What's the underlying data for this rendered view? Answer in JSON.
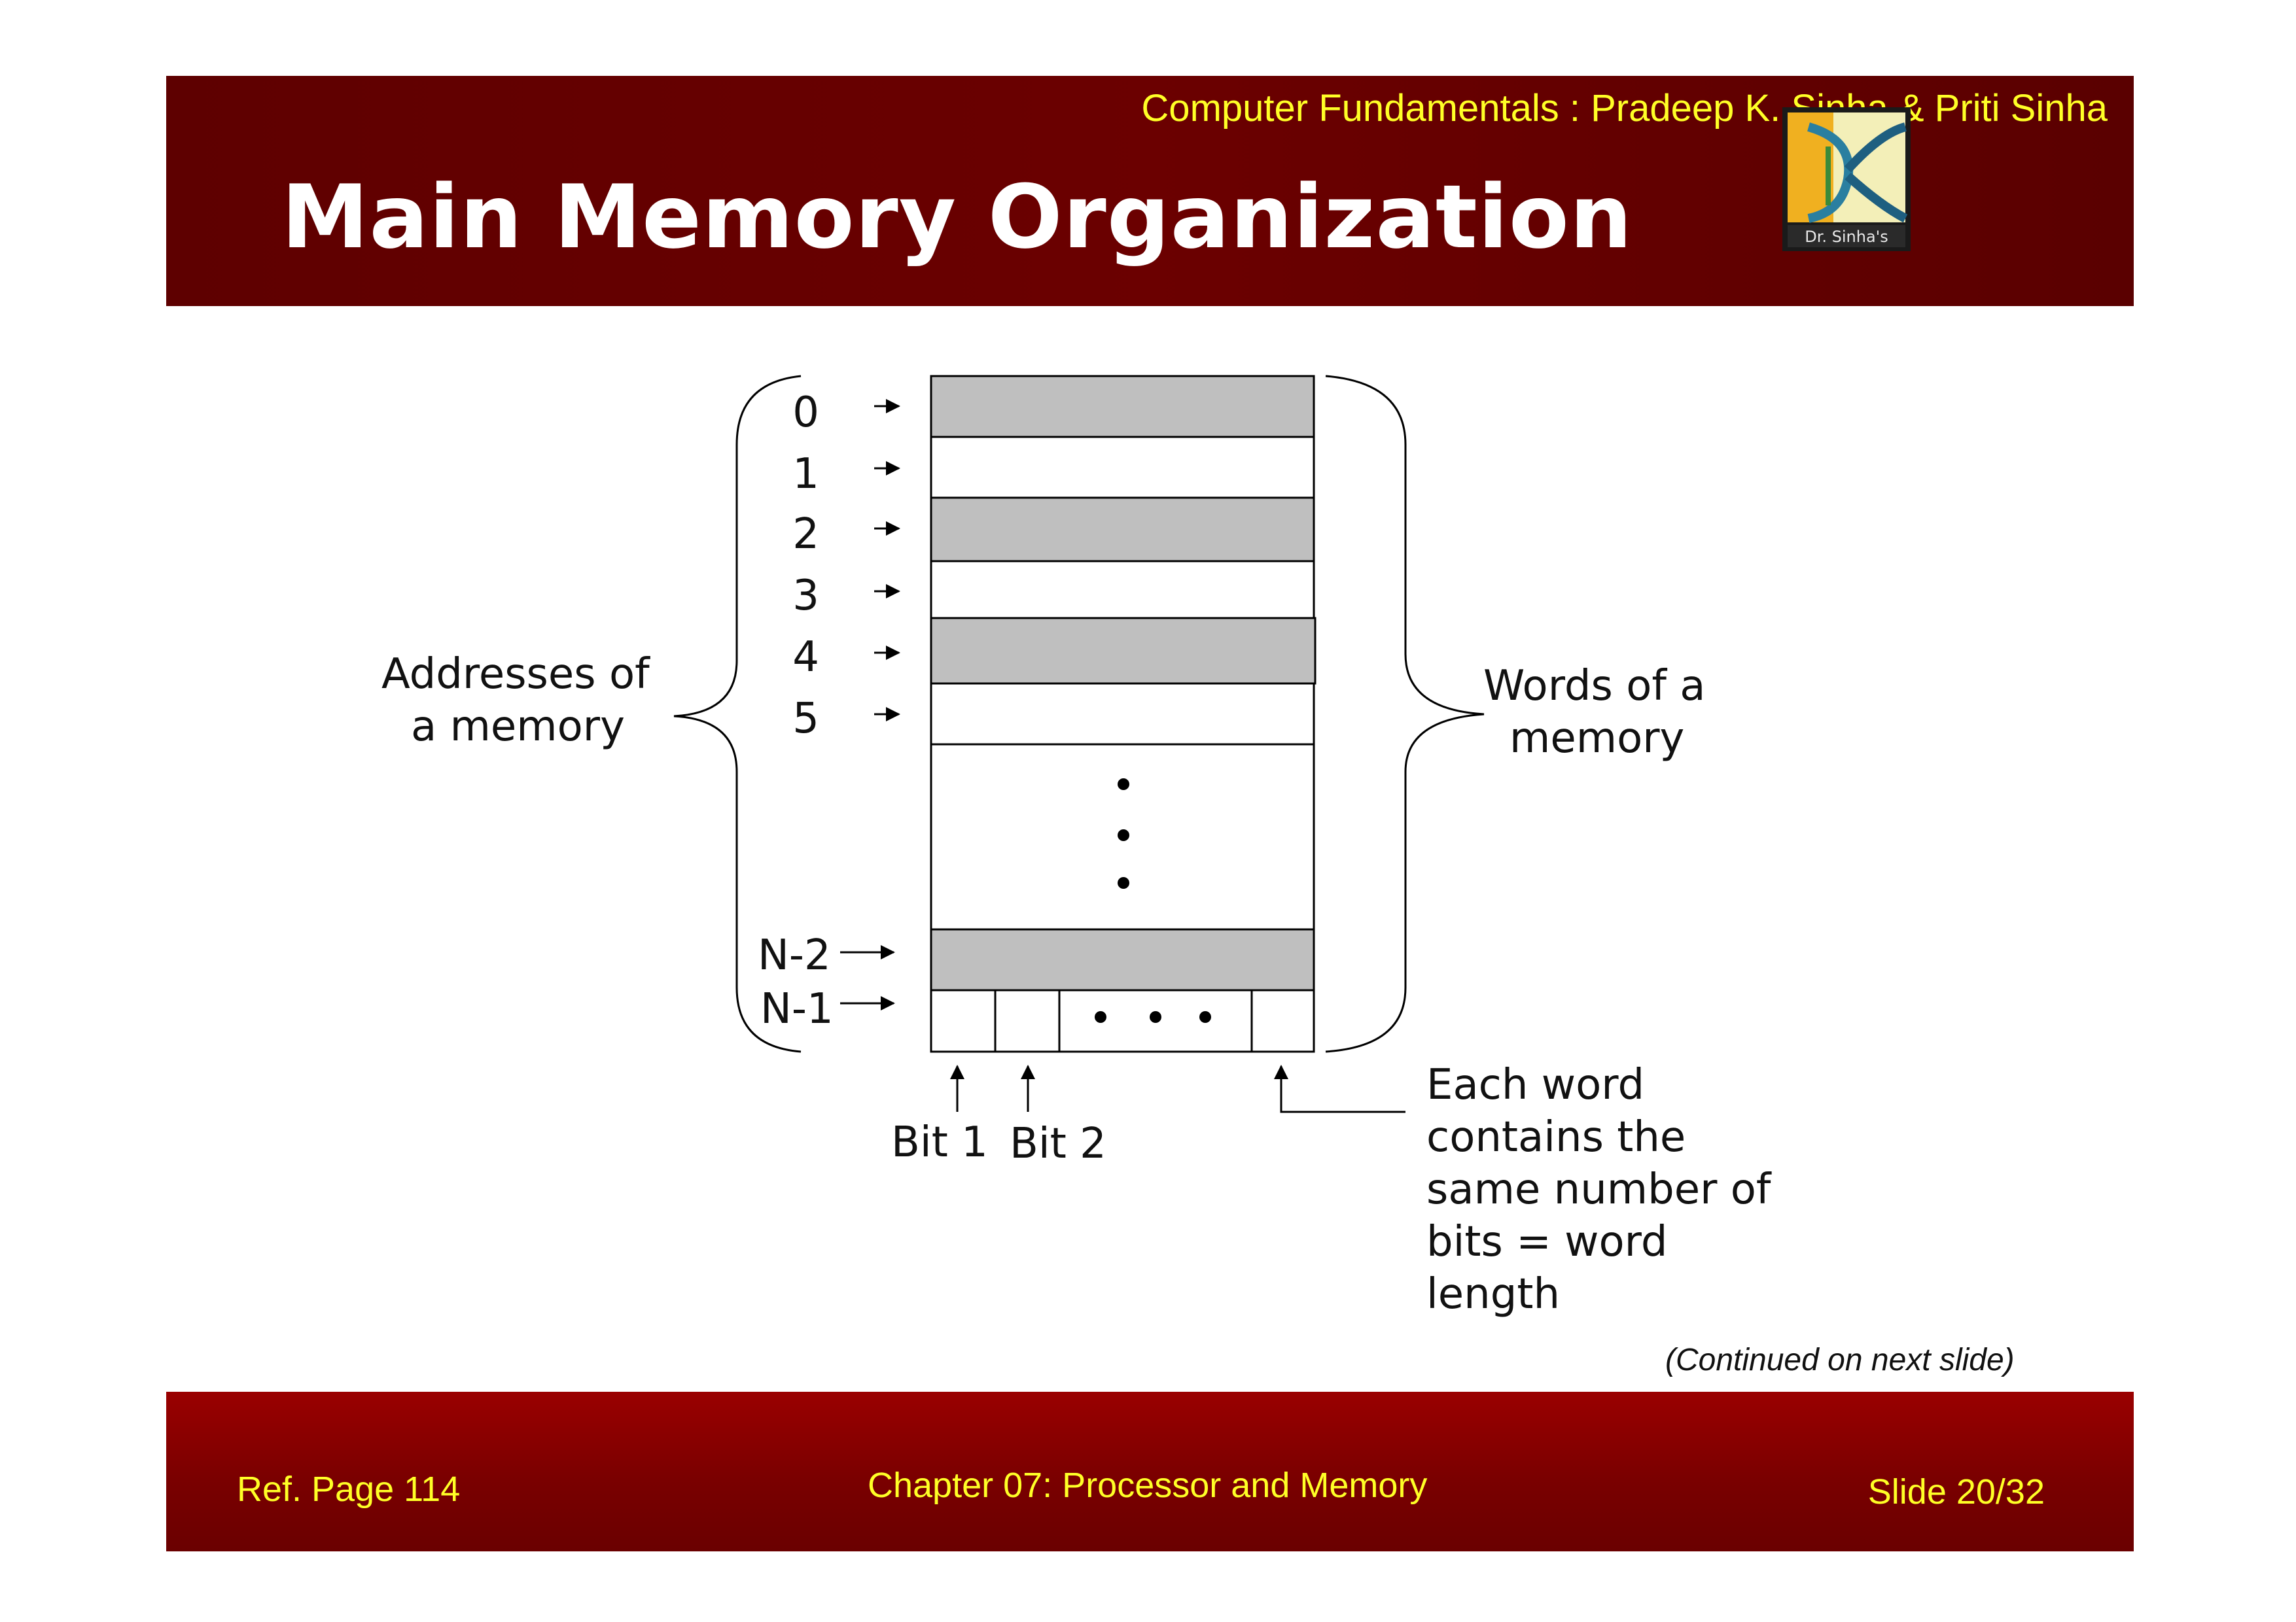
{
  "header": {
    "book_title": "Computer Fundamentals : Pradeep K. Sinha & Priti Sinha",
    "slide_title": "Main Memory Organization",
    "logo_text": "Dr. Sinha's"
  },
  "diagram": {
    "addresses": [
      "0",
      "1",
      "2",
      "3",
      "4",
      "5",
      "N-2",
      "N-1"
    ],
    "left_caption": [
      "Addresses of",
      "a memory"
    ],
    "right_caption": [
      "Words of a",
      "memory"
    ],
    "bit_labels": [
      "Bit 1",
      "Bit 2"
    ],
    "word_note": [
      "Each word",
      "contains the",
      "same number of",
      "bits = word",
      "length"
    ]
  },
  "continued_note": "(Continued on next slide)",
  "footer": {
    "ref_page": "Ref. Page  114",
    "chapter": "Chapter 07: Processor and Memory",
    "slide_number": "Slide 20/32"
  },
  "colors": {
    "header_bg": "#5e0000",
    "footer_bg": "#8a0000",
    "accent_text": "#ffff26",
    "shaded_word": "#bfbfbf"
  }
}
